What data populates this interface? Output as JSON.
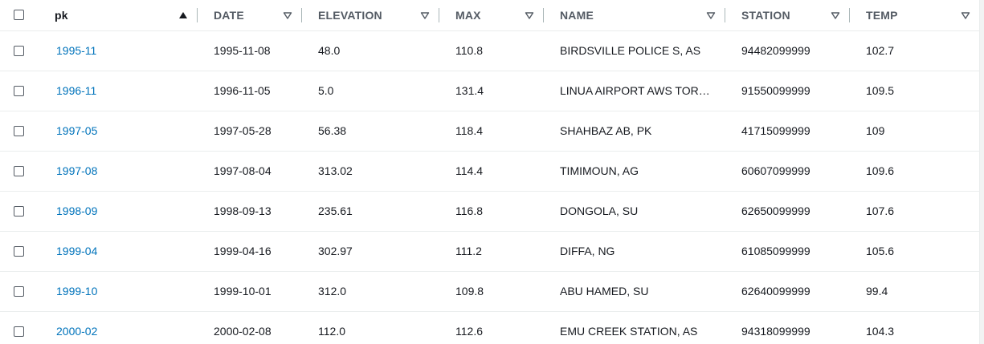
{
  "columns": [
    {
      "key": "pk",
      "label": "pk",
      "sort": "ascending"
    },
    {
      "key": "date",
      "label": "DATE",
      "sort": "none"
    },
    {
      "key": "elevation",
      "label": "ELEVATION",
      "sort": "none"
    },
    {
      "key": "max",
      "label": "MAX",
      "sort": "none"
    },
    {
      "key": "name",
      "label": "NAME",
      "sort": "none"
    },
    {
      "key": "station",
      "label": "STATION",
      "sort": "none"
    },
    {
      "key": "temp",
      "label": "TEMP",
      "sort": "none"
    }
  ],
  "rows": [
    {
      "pk": "1995-11",
      "date": "1995-11-08",
      "elevation": "48.0",
      "max": "110.8",
      "name": "BIRDSVILLE POLICE S, AS",
      "station": "94482099999",
      "temp": "102.7"
    },
    {
      "pk": "1996-11",
      "date": "1996-11-05",
      "elevation": "5.0",
      "max": "131.4",
      "name": "LINUA AIRPORT AWS TOR…",
      "station": "91550099999",
      "temp": "109.5"
    },
    {
      "pk": "1997-05",
      "date": "1997-05-28",
      "elevation": "56.38",
      "max": "118.4",
      "name": "SHAHBAZ AB, PK",
      "station": "41715099999",
      "temp": "109"
    },
    {
      "pk": "1997-08",
      "date": "1997-08-04",
      "elevation": "313.02",
      "max": "114.4",
      "name": "TIMIMOUN, AG",
      "station": "60607099999",
      "temp": "109.6"
    },
    {
      "pk": "1998-09",
      "date": "1998-09-13",
      "elevation": "235.61",
      "max": "116.8",
      "name": "DONGOLA, SU",
      "station": "62650099999",
      "temp": "107.6"
    },
    {
      "pk": "1999-04",
      "date": "1999-04-16",
      "elevation": "302.97",
      "max": "111.2",
      "name": "DIFFA, NG",
      "station": "61085099999",
      "temp": "105.6"
    },
    {
      "pk": "1999-10",
      "date": "1999-10-01",
      "elevation": "312.0",
      "max": "109.8",
      "name": "ABU HAMED, SU",
      "station": "62640099999",
      "temp": "99.4"
    },
    {
      "pk": "2000-02",
      "date": "2000-02-08",
      "elevation": "112.0",
      "max": "112.6",
      "name": "EMU CREEK STATION, AS",
      "station": "94318099999",
      "temp": "104.3"
    }
  ],
  "colors": {
    "link": "#0073bb",
    "header_text": "#545b64",
    "row_border": "#eaeded"
  },
  "icons": {
    "sort_ascending": "triangle-up-filled-icon",
    "sort_none": "triangle-down-outline-icon",
    "checkbox": "checkbox-unchecked-icon"
  }
}
